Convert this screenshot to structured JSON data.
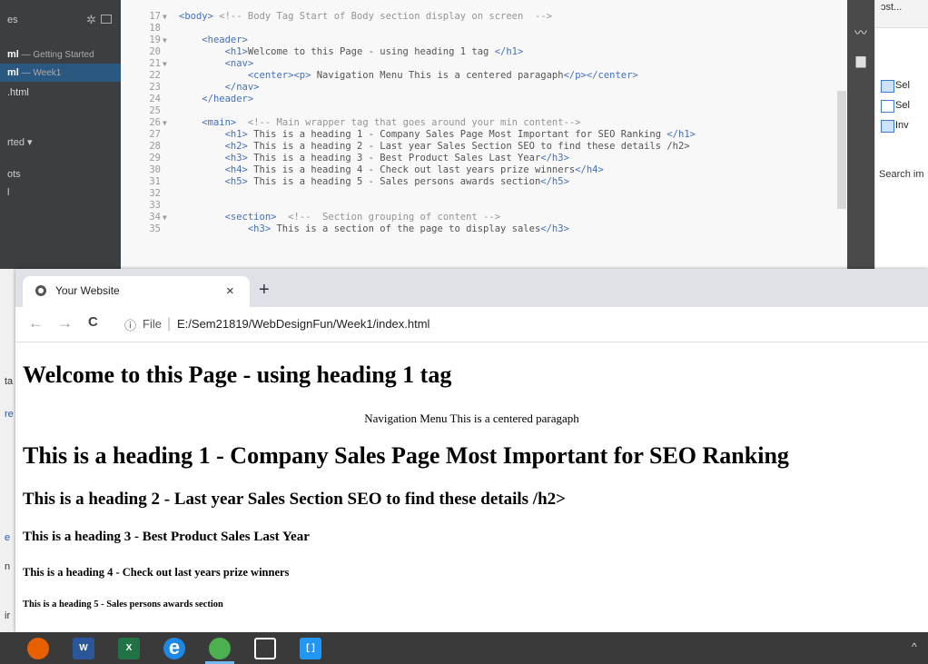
{
  "sidebar": {
    "title": "es",
    "working_files": [
      {
        "name": "ml",
        "sub": " — Getting Started"
      },
      {
        "name": "ml",
        "sub": " — Week1"
      },
      {
        "name": ".html",
        "sub": ""
      }
    ],
    "project": "rted ▾",
    "tree": [
      "ots",
      "l"
    ]
  },
  "editor": {
    "lines": [
      {
        "n": "17",
        "fold": "▼",
        "html": "<span class=\"tg\">&lt;body&gt;</span> <span class=\"cm\">&lt;!-- Body Tag Start of Body section display on screen  --&gt;</span>"
      },
      {
        "n": "18",
        "fold": "",
        "html": ""
      },
      {
        "n": "19",
        "fold": "▼",
        "html": "    <span class=\"tg\">&lt;header&gt;</span>"
      },
      {
        "n": "20",
        "fold": "",
        "html": "        <span class=\"tg\">&lt;h1&gt;</span>Welcome to this Page - using heading 1 tag <span class=\"tg\">&lt;/h1&gt;</span>"
      },
      {
        "n": "21",
        "fold": "▼",
        "html": "        <span class=\"tg\">&lt;nav&gt;</span>"
      },
      {
        "n": "22",
        "fold": "",
        "html": "            <span class=\"tg\">&lt;center&gt;&lt;p&gt;</span> Navigation Menu This is a centered paragaph<span class=\"tg\">&lt;/p&gt;&lt;/center&gt;</span>"
      },
      {
        "n": "23",
        "fold": "",
        "html": "        <span class=\"tg\">&lt;/nav&gt;</span>"
      },
      {
        "n": "24",
        "fold": "",
        "html": "    <span class=\"tg\">&lt;/header&gt;</span>"
      },
      {
        "n": "25",
        "fold": "",
        "html": ""
      },
      {
        "n": "26",
        "fold": "▼",
        "html": "    <span class=\"tg\">&lt;main&gt;</span>  <span class=\"cm\">&lt;!-- Main wrapper tag that goes around your min content--&gt;</span>"
      },
      {
        "n": "27",
        "fold": "",
        "html": "        <span class=\"tg\">&lt;h1&gt;</span> This is a heading 1 - Company Sales Page Most Important for SEO Ranking <span class=\"tg\">&lt;/h1&gt;</span>"
      },
      {
        "n": "28",
        "fold": "",
        "html": "        <span class=\"tg\">&lt;h2&gt;</span> This is a heading 2 - Last year Sales Section SEO to find these details /h2&gt;"
      },
      {
        "n": "29",
        "fold": "",
        "html": "        <span class=\"tg\">&lt;h3&gt;</span> This is a heading 3 - Best Product Sales Last Year<span class=\"tg\">&lt;/h3&gt;</span>"
      },
      {
        "n": "30",
        "fold": "",
        "html": "        <span class=\"tg\">&lt;h4&gt;</span> This is a heading 4 - Check out last years prize winners<span class=\"tg\">&lt;/h4&gt;</span>"
      },
      {
        "n": "31",
        "fold": "",
        "html": "        <span class=\"tg\">&lt;h5&gt;</span> This is a heading 5 - Sales persons awards section<span class=\"tg\">&lt;/h5&gt;</span>"
      },
      {
        "n": "32",
        "fold": "",
        "html": ""
      },
      {
        "n": "33",
        "fold": "",
        "html": ""
      },
      {
        "n": "34",
        "fold": "▼",
        "html": "        <span class=\"tg\">&lt;section&gt;</span>  <span class=\"cm\">&lt;!--  Section grouping of content --&gt;</span>"
      },
      {
        "n": "35",
        "fold": "",
        "html": "            <span class=\"tg\">&lt;h3&gt;</span> This is a section of the page to display sales<span class=\"tg\">&lt;/h3&gt;</span>"
      }
    ]
  },
  "rightwin": {
    "dropdown": "ɔst...",
    "items": [
      "Sel",
      "Sel",
      "Inv"
    ],
    "search": "Search im"
  },
  "leftstrip": [
    "ta",
    "re",
    "e",
    "n",
    "ir"
  ],
  "browser": {
    "tab_title": "Your Website",
    "tab_close": "×",
    "new_tab": "+",
    "back": "←",
    "forward": "→",
    "reload": "C",
    "info": "ⓘ",
    "scheme_label": "File",
    "url": "E:/Sem21819/WebDesignFun/Week1/index.html"
  },
  "page": {
    "h1_header": "Welcome to this Page - using heading 1 tag",
    "nav_text": "Navigation Menu This is a centered paragaph",
    "h1": "This is a heading 1 - Company Sales Page Most Important for SEO Ranking",
    "h2": "This is a heading 2 - Last year Sales Section SEO to find these details /h2>",
    "h3": "This is a heading 3 - Best Product Sales Last Year",
    "h4": "This is a heading 4 - Check out last years prize winners",
    "h5": "This is a heading 5 - Sales persons awards section"
  },
  "taskbar": {
    "apps": [
      {
        "name": "firefox",
        "label": "",
        "color": "#e66000"
      },
      {
        "name": "word",
        "label": "W",
        "color": "#2b579a"
      },
      {
        "name": "excel",
        "label": "X",
        "color": "#217346"
      },
      {
        "name": "edge",
        "label": "e",
        "color": "#1e88e5"
      },
      {
        "name": "chrome",
        "label": "",
        "color": "#4caf50"
      },
      {
        "name": "photos",
        "label": "",
        "color": "#3a3a3a"
      },
      {
        "name": "brackets",
        "label": "[ ]",
        "color": "#2196f3"
      }
    ],
    "tray": "^"
  }
}
